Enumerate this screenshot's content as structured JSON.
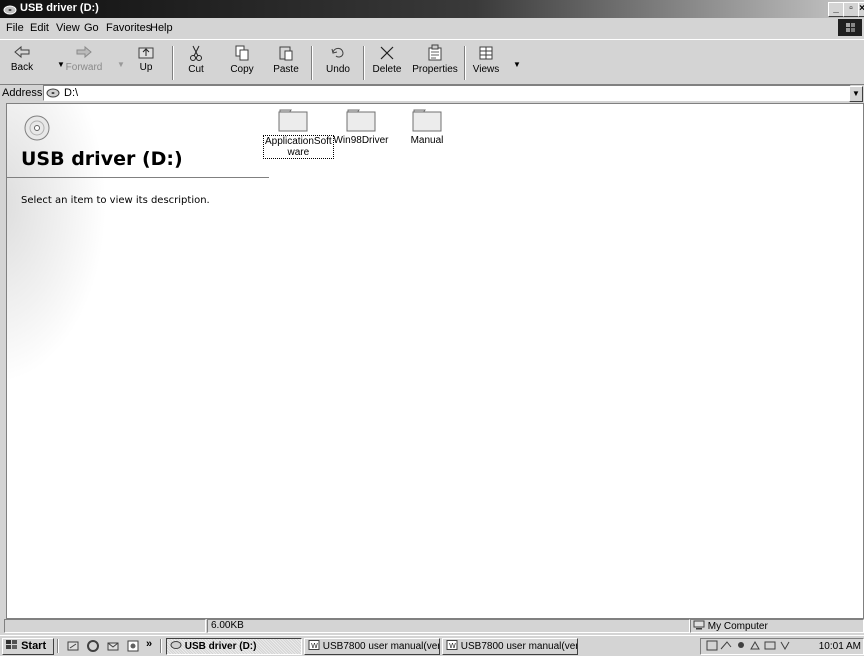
{
  "window": {
    "title": "USB driver (D:)"
  },
  "menu": {
    "items": [
      {
        "label": "File"
      },
      {
        "label": "Edit"
      },
      {
        "label": "View"
      },
      {
        "label": "Go"
      },
      {
        "label": "Favorites"
      },
      {
        "label": "Help"
      }
    ]
  },
  "toolbar": {
    "back": "Back",
    "forward": "Forward",
    "up": "Up",
    "cut": "Cut",
    "copy": "Copy",
    "paste": "Paste",
    "undo": "Undo",
    "delete": "Delete",
    "properties": "Properties",
    "views": "Views"
  },
  "address": {
    "label": "Address",
    "value": "D:\\"
  },
  "webview": {
    "title": "USB driver (D:)",
    "description": "Select an item to view its description."
  },
  "files": [
    {
      "name_line1": "ApplicationSoft",
      "name_line2": "ware",
      "icon": "folder-icon",
      "selected": true
    },
    {
      "name_line1": "Win98Driver",
      "name_line2": "",
      "icon": "folder-icon",
      "selected": false
    },
    {
      "name_line1": "Manual",
      "name_line2": "",
      "icon": "folder-icon",
      "selected": false
    }
  ],
  "status": {
    "size": "6.00KB",
    "zone": "My Computer"
  },
  "taskbar": {
    "start": "Start",
    "chevron": "»",
    "apps": [
      {
        "label": "USB driver (D:)",
        "active": true
      },
      {
        "label": "USB7800 user manual(ver...",
        "active": false
      },
      {
        "label": "USB7800 user manual(ver...",
        "active": false
      }
    ],
    "clock": "10:01 AM"
  }
}
